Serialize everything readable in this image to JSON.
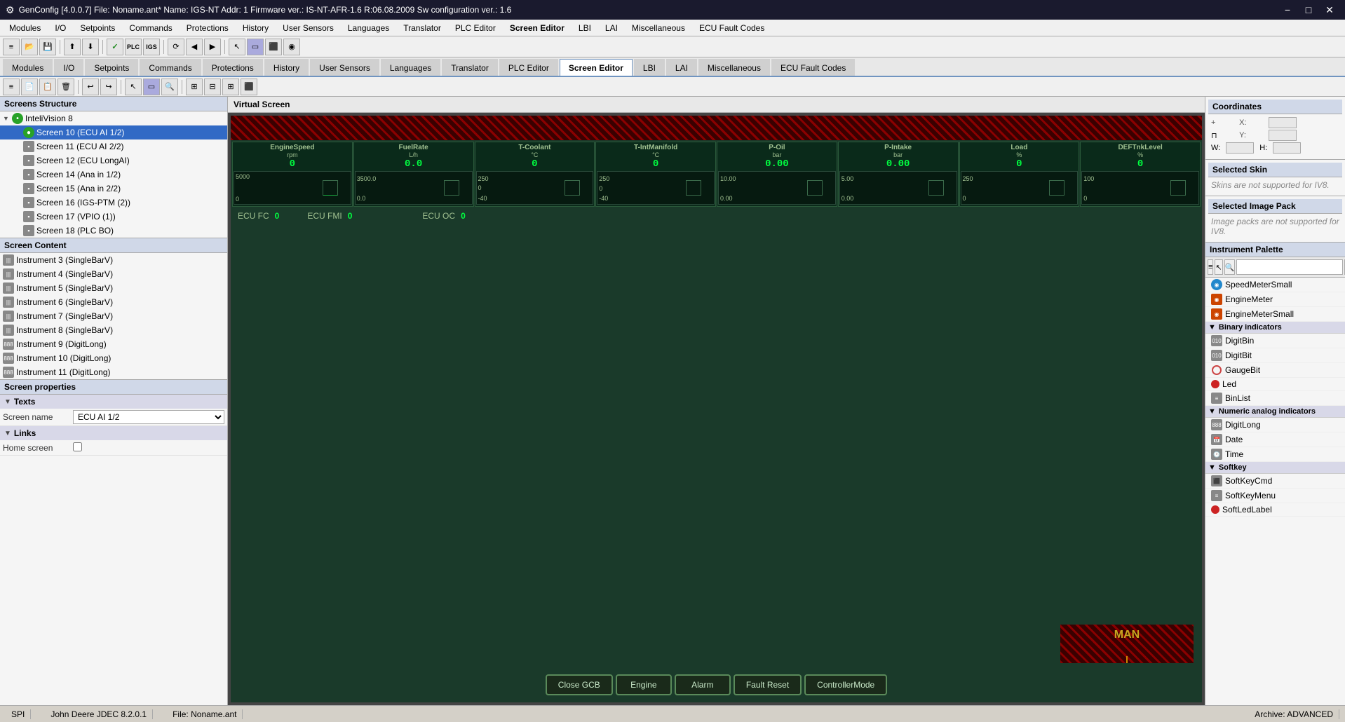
{
  "titlebar": {
    "title": "GenConfig [4.0.0.7]  File: Noname.ant*  Name: IGS-NT  Addr: 1  Firmware ver.: IS-NT-AFR-1.6 R:06.08.2009  Sw configuration ver.: 1.6",
    "min_label": "−",
    "max_label": "□",
    "close_label": "✕"
  },
  "menubar": {
    "items": [
      "Modules",
      "I/O",
      "Setpoints",
      "Commands",
      "Protections",
      "History",
      "User Sensors",
      "Languages",
      "Translator",
      "PLC Editor",
      "Screen Editor",
      "LBI",
      "LAI",
      "Miscellaneous",
      "ECU Fault Codes"
    ]
  },
  "toolbar": {
    "buttons": [
      "≡",
      "📁",
      "💾",
      "⬛",
      "⬛",
      "✓",
      "PLC",
      "IGS",
      "⟳",
      "◀",
      "▶",
      "⬛",
      "⬛",
      "⬛",
      "⬛",
      "⬛",
      "⬛"
    ]
  },
  "toolbar2": {
    "buttons": [
      "≡",
      "◀",
      "▶",
      "↩",
      "↪",
      "⬛",
      "⬛",
      "⬛",
      "⬛",
      "⬛",
      "⬛",
      "⬛"
    ]
  },
  "virtual_screen": {
    "header": "Virtual Screen",
    "instruments": [
      {
        "label": "EngineSpeed",
        "unit": "rpm",
        "value": "0",
        "max": "5000",
        "mid": "",
        "zero": "0",
        "min_display": ""
      },
      {
        "label": "FuelRate",
        "unit": "L/h",
        "value": "0.0",
        "max": "3500.0",
        "mid": "",
        "zero": "0.0",
        "min_display": ""
      },
      {
        "label": "T-Coolant",
        "unit": "°C",
        "value": "0",
        "max": "250",
        "mid": "",
        "zero": "0",
        "min_display": "-40"
      },
      {
        "label": "T-IntManifold",
        "unit": "°C",
        "value": "0",
        "max": "250",
        "mid": "",
        "zero": "0",
        "min_display": "-40"
      },
      {
        "label": "P-Oil",
        "unit": "bar",
        "value": "0.00",
        "max": "10.00",
        "mid": "",
        "zero": "0.00",
        "min_display": ""
      },
      {
        "label": "P-Intake",
        "unit": "bar",
        "value": "0.00",
        "max": "5.00",
        "mid": "",
        "zero": "0.00",
        "min_display": ""
      },
      {
        "label": "Load",
        "unit": "%",
        "value": "0",
        "max": "250",
        "mid": "",
        "zero": "0",
        "min_display": ""
      },
      {
        "label": "DEFTnkLevel",
        "unit": "%",
        "value": "0",
        "max": "100",
        "mid": "",
        "zero": "0",
        "min_display": ""
      }
    ],
    "status_items": [
      {
        "label": "ECU FC",
        "value": "0"
      },
      {
        "label": "ECU FMI",
        "value": "0"
      },
      {
        "label": "ECU OC",
        "value": "0"
      }
    ],
    "man_label": "MAN",
    "buttons": [
      "Close GCB",
      "Engine",
      "Alarm",
      "Fault Reset",
      "ControllerMode"
    ]
  },
  "screen_structure": {
    "header": "Screens Structure",
    "root": "InteliVision 8",
    "items": [
      {
        "label": "Screen 10 (ECU AI 1/2)",
        "selected": true,
        "indent": 2
      },
      {
        "label": "Screen 11 (ECU AI 2/2)",
        "selected": false,
        "indent": 2
      },
      {
        "label": "Screen 12 (ECU LongAI)",
        "selected": false,
        "indent": 2
      },
      {
        "label": "Screen 14 (Ana in 1/2)",
        "selected": false,
        "indent": 2
      },
      {
        "label": "Screen 15 (Ana in 2/2)",
        "selected": false,
        "indent": 2
      },
      {
        "label": "Screen 16 (IGS-PTM (2))",
        "selected": false,
        "indent": 2
      },
      {
        "label": "Screen 17 (VPIO (1))",
        "selected": false,
        "indent": 2
      },
      {
        "label": "Screen 18 (PLC BO)",
        "selected": false,
        "indent": 2
      }
    ]
  },
  "screen_content": {
    "header": "Screen Content",
    "items": [
      "Instrument 3 (SingleBarV)",
      "Instrument 4 (SingleBarV)",
      "Instrument 5 (SingleBarV)",
      "Instrument 6 (SingleBarV)",
      "Instrument 7 (SingleBarV)",
      "Instrument 8 (SingleBarV)",
      "Instrument 9 (DigitLong)",
      "Instrument 10 (DigitLong)",
      "Instrument 11 (DigitLong)"
    ]
  },
  "screen_properties": {
    "header": "Screen properties",
    "sections": {
      "texts": {
        "label": "Texts",
        "collapsed": false
      },
      "links": {
        "label": "Links",
        "collapsed": false
      }
    },
    "screen_name_label": "Screen name",
    "screen_name_value": "ECU AI 1/2",
    "home_screen_label": "Home screen",
    "home_screen_checked": false
  },
  "right_panel": {
    "coordinates": {
      "header": "Coordinates",
      "x_label": "X:",
      "y_label": "Y:",
      "w_label": "W:",
      "h_label": "H:"
    },
    "selected_skin": {
      "header": "Selected Skin",
      "message": "Skins are not supported for IV8."
    },
    "selected_image_pack": {
      "header": "Selected Image Pack",
      "message": "Image packs are not supported for IV8."
    },
    "instrument_palette": {
      "header": "Instrument Palette",
      "items_before_binary": [
        {
          "label": "SpeedMeterSmall",
          "icon_type": "speedmeter"
        },
        {
          "label": "EngineMeter",
          "icon_type": "engine"
        },
        {
          "label": "EngineMeterSmall",
          "icon_type": "engine"
        }
      ],
      "categories": [
        {
          "label": "Binary indicators",
          "expanded": true,
          "items": [
            {
              "label": "DigitBin",
              "icon_type": "binary"
            },
            {
              "label": "DigitBit",
              "icon_type": "binary"
            },
            {
              "label": "GaugeBit",
              "icon_type": "gauge"
            },
            {
              "label": "Led",
              "icon_type": "led"
            },
            {
              "label": "BinList",
              "icon_type": "binary"
            }
          ]
        },
        {
          "label": "Numeric analog indicators",
          "expanded": true,
          "items": [
            {
              "label": "DigitLong",
              "icon_type": "binary"
            },
            {
              "label": "Date",
              "icon_type": "binary"
            },
            {
              "label": "Time",
              "icon_type": "binary"
            }
          ]
        },
        {
          "label": "Softkey",
          "expanded": false,
          "items": [
            {
              "label": "SoftKeyCmd",
              "icon_type": "binary"
            },
            {
              "label": "SoftKeyMenu",
              "icon_type": "binary"
            },
            {
              "label": "SoftLedLabel",
              "icon_type": "led"
            }
          ]
        }
      ]
    }
  },
  "status_bar": {
    "protocol": "SPI",
    "device": "John Deere JDEC 8.2.0.1",
    "file": "File: Noname.ant",
    "archive": "Archive: ADVANCED"
  }
}
